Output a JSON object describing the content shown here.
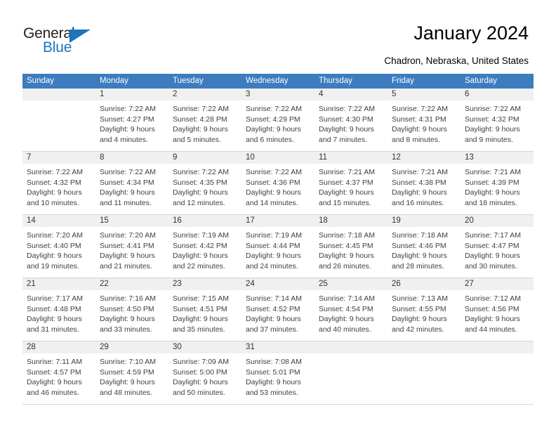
{
  "brand": {
    "name_part1": "General",
    "name_part2": "Blue",
    "accent_color": "#1b75bc"
  },
  "header": {
    "title": "January 2024",
    "subtitle": "Chadron, Nebraska, United States",
    "header_bg_color": "#3c7cbf"
  },
  "weekdays": [
    "Sunday",
    "Monday",
    "Tuesday",
    "Wednesday",
    "Thursday",
    "Friday",
    "Saturday"
  ],
  "weeks": [
    [
      {
        "day": "",
        "lines": []
      },
      {
        "day": "1",
        "lines": [
          "Sunrise: 7:22 AM",
          "Sunset: 4:27 PM",
          "Daylight: 9 hours",
          "and 4 minutes."
        ]
      },
      {
        "day": "2",
        "lines": [
          "Sunrise: 7:22 AM",
          "Sunset: 4:28 PM",
          "Daylight: 9 hours",
          "and 5 minutes."
        ]
      },
      {
        "day": "3",
        "lines": [
          "Sunrise: 7:22 AM",
          "Sunset: 4:29 PM",
          "Daylight: 9 hours",
          "and 6 minutes."
        ]
      },
      {
        "day": "4",
        "lines": [
          "Sunrise: 7:22 AM",
          "Sunset: 4:30 PM",
          "Daylight: 9 hours",
          "and 7 minutes."
        ]
      },
      {
        "day": "5",
        "lines": [
          "Sunrise: 7:22 AM",
          "Sunset: 4:31 PM",
          "Daylight: 9 hours",
          "and 8 minutes."
        ]
      },
      {
        "day": "6",
        "lines": [
          "Sunrise: 7:22 AM",
          "Sunset: 4:32 PM",
          "Daylight: 9 hours",
          "and 9 minutes."
        ]
      }
    ],
    [
      {
        "day": "7",
        "lines": [
          "Sunrise: 7:22 AM",
          "Sunset: 4:32 PM",
          "Daylight: 9 hours",
          "and 10 minutes."
        ]
      },
      {
        "day": "8",
        "lines": [
          "Sunrise: 7:22 AM",
          "Sunset: 4:34 PM",
          "Daylight: 9 hours",
          "and 11 minutes."
        ]
      },
      {
        "day": "9",
        "lines": [
          "Sunrise: 7:22 AM",
          "Sunset: 4:35 PM",
          "Daylight: 9 hours",
          "and 12 minutes."
        ]
      },
      {
        "day": "10",
        "lines": [
          "Sunrise: 7:22 AM",
          "Sunset: 4:36 PM",
          "Daylight: 9 hours",
          "and 14 minutes."
        ]
      },
      {
        "day": "11",
        "lines": [
          "Sunrise: 7:21 AM",
          "Sunset: 4:37 PM",
          "Daylight: 9 hours",
          "and 15 minutes."
        ]
      },
      {
        "day": "12",
        "lines": [
          "Sunrise: 7:21 AM",
          "Sunset: 4:38 PM",
          "Daylight: 9 hours",
          "and 16 minutes."
        ]
      },
      {
        "day": "13",
        "lines": [
          "Sunrise: 7:21 AM",
          "Sunset: 4:39 PM",
          "Daylight: 9 hours",
          "and 18 minutes."
        ]
      }
    ],
    [
      {
        "day": "14",
        "lines": [
          "Sunrise: 7:20 AM",
          "Sunset: 4:40 PM",
          "Daylight: 9 hours",
          "and 19 minutes."
        ]
      },
      {
        "day": "15",
        "lines": [
          "Sunrise: 7:20 AM",
          "Sunset: 4:41 PM",
          "Daylight: 9 hours",
          "and 21 minutes."
        ]
      },
      {
        "day": "16",
        "lines": [
          "Sunrise: 7:19 AM",
          "Sunset: 4:42 PM",
          "Daylight: 9 hours",
          "and 22 minutes."
        ]
      },
      {
        "day": "17",
        "lines": [
          "Sunrise: 7:19 AM",
          "Sunset: 4:44 PM",
          "Daylight: 9 hours",
          "and 24 minutes."
        ]
      },
      {
        "day": "18",
        "lines": [
          "Sunrise: 7:18 AM",
          "Sunset: 4:45 PM",
          "Daylight: 9 hours",
          "and 26 minutes."
        ]
      },
      {
        "day": "19",
        "lines": [
          "Sunrise: 7:18 AM",
          "Sunset: 4:46 PM",
          "Daylight: 9 hours",
          "and 28 minutes."
        ]
      },
      {
        "day": "20",
        "lines": [
          "Sunrise: 7:17 AM",
          "Sunset: 4:47 PM",
          "Daylight: 9 hours",
          "and 30 minutes."
        ]
      }
    ],
    [
      {
        "day": "21",
        "lines": [
          "Sunrise: 7:17 AM",
          "Sunset: 4:48 PM",
          "Daylight: 9 hours",
          "and 31 minutes."
        ]
      },
      {
        "day": "22",
        "lines": [
          "Sunrise: 7:16 AM",
          "Sunset: 4:50 PM",
          "Daylight: 9 hours",
          "and 33 minutes."
        ]
      },
      {
        "day": "23",
        "lines": [
          "Sunrise: 7:15 AM",
          "Sunset: 4:51 PM",
          "Daylight: 9 hours",
          "and 35 minutes."
        ]
      },
      {
        "day": "24",
        "lines": [
          "Sunrise: 7:14 AM",
          "Sunset: 4:52 PM",
          "Daylight: 9 hours",
          "and 37 minutes."
        ]
      },
      {
        "day": "25",
        "lines": [
          "Sunrise: 7:14 AM",
          "Sunset: 4:54 PM",
          "Daylight: 9 hours",
          "and 40 minutes."
        ]
      },
      {
        "day": "26",
        "lines": [
          "Sunrise: 7:13 AM",
          "Sunset: 4:55 PM",
          "Daylight: 9 hours",
          "and 42 minutes."
        ]
      },
      {
        "day": "27",
        "lines": [
          "Sunrise: 7:12 AM",
          "Sunset: 4:56 PM",
          "Daylight: 9 hours",
          "and 44 minutes."
        ]
      }
    ],
    [
      {
        "day": "28",
        "lines": [
          "Sunrise: 7:11 AM",
          "Sunset: 4:57 PM",
          "Daylight: 9 hours",
          "and 46 minutes."
        ]
      },
      {
        "day": "29",
        "lines": [
          "Sunrise: 7:10 AM",
          "Sunset: 4:59 PM",
          "Daylight: 9 hours",
          "and 48 minutes."
        ]
      },
      {
        "day": "30",
        "lines": [
          "Sunrise: 7:09 AM",
          "Sunset: 5:00 PM",
          "Daylight: 9 hours",
          "and 50 minutes."
        ]
      },
      {
        "day": "31",
        "lines": [
          "Sunrise: 7:08 AM",
          "Sunset: 5:01 PM",
          "Daylight: 9 hours",
          "and 53 minutes."
        ]
      },
      {
        "day": "",
        "lines": []
      },
      {
        "day": "",
        "lines": []
      },
      {
        "day": "",
        "lines": []
      }
    ]
  ]
}
